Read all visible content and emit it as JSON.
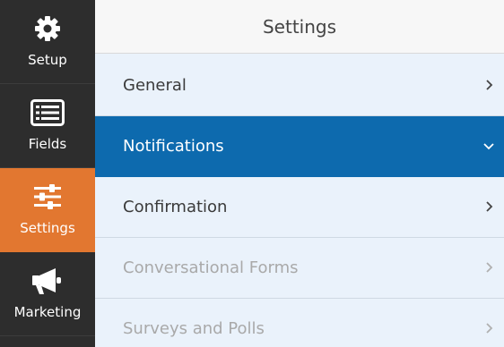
{
  "sidebar": {
    "items": [
      {
        "label": "Setup",
        "icon": "gear-icon"
      },
      {
        "label": "Fields",
        "icon": "list-icon"
      },
      {
        "label": "Settings",
        "icon": "sliders-icon",
        "active": true
      },
      {
        "label": "Marketing",
        "icon": "megaphone-icon"
      }
    ]
  },
  "panel": {
    "title": "Settings",
    "items": [
      {
        "label": "General",
        "state": "collapsed"
      },
      {
        "label": "Notifications",
        "state": "expanded"
      },
      {
        "label": "Confirmation",
        "state": "collapsed"
      },
      {
        "label": "Conversational Forms",
        "state": "disabled"
      },
      {
        "label": "Surveys and Polls",
        "state": "disabled"
      }
    ]
  },
  "colors": {
    "sidebar_bg": "#2d2d2d",
    "sidebar_active": "#e27730",
    "panel_bg": "#eaf2fb",
    "row_active": "#0d6aae"
  }
}
